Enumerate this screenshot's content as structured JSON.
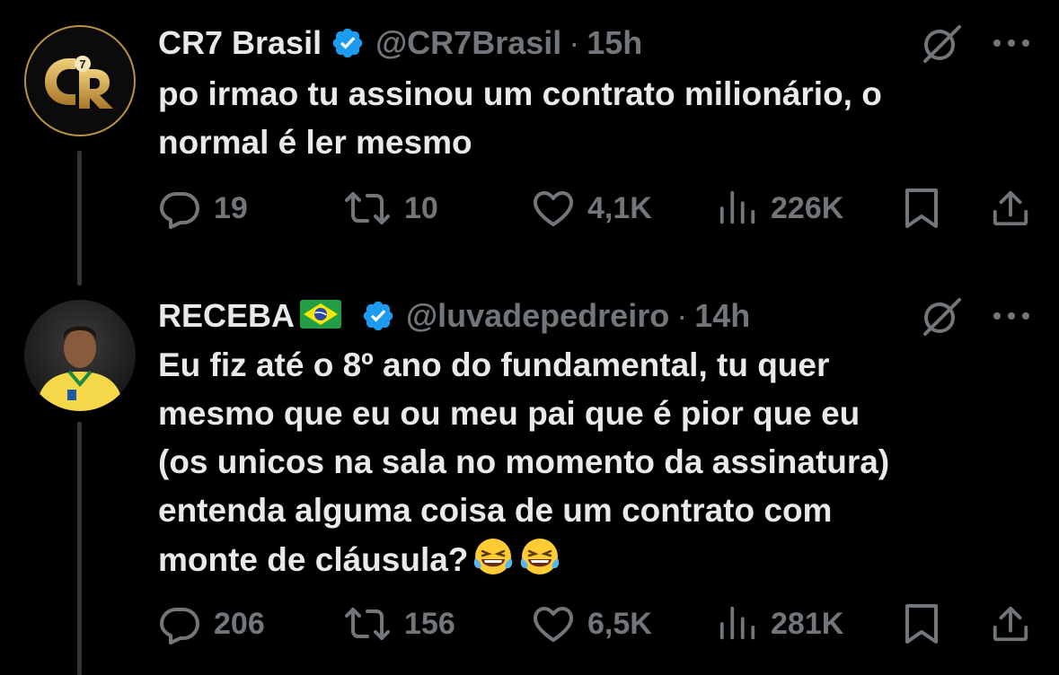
{
  "colors": {
    "background": "#000000",
    "text": "#e7e9ea",
    "secondary": "#71767b",
    "verified": "#1d9bf0",
    "thread_line": "#333639"
  },
  "tweets": [
    {
      "name": "CR7 Brasil",
      "handle": "@CR7Brasil",
      "separator": "·",
      "time": "15h",
      "avatar_text": "7",
      "lines": [
        "po irmao tu assinou um contrato milionário, o",
        "normal é ler mesmo"
      ],
      "replies": "19",
      "reposts": "10",
      "likes": "4,1K",
      "views": "226K"
    },
    {
      "name": "RECEBA",
      "handle": "@luvadepedreiro",
      "separator": "·",
      "time": "14h",
      "lines": [
        "Eu fiz até o 8º ano do fundamental, tu quer",
        "mesmo que eu ou meu pai que é pior que eu",
        "(os unicos na sala no momento da assinatura)",
        "entenda alguma coisa de um contrato com",
        "monte de cláusula?"
      ],
      "replies": "206",
      "reposts": "156",
      "likes": "6,5K",
      "views": "281K"
    }
  ]
}
